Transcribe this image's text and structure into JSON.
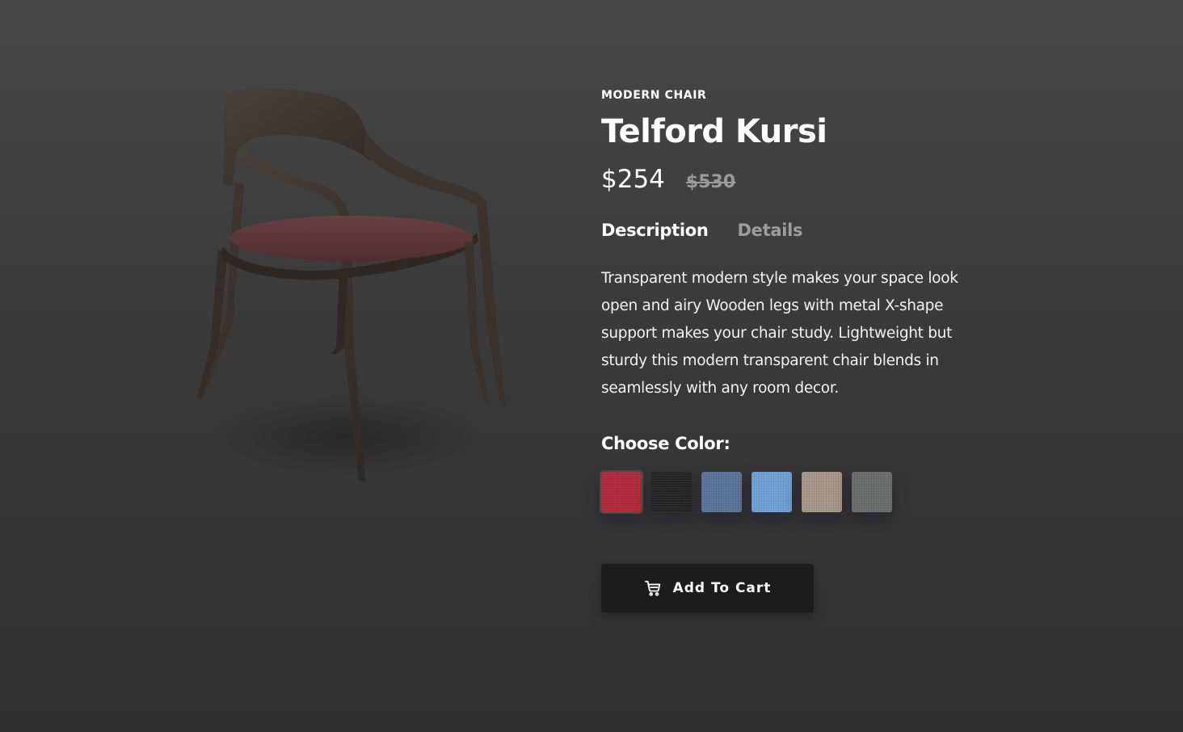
{
  "product": {
    "category": "MODERN CHAIR",
    "title": "Telford Kursi",
    "price_current": "$254",
    "price_old": "$530",
    "image_icon": "chair-image"
  },
  "tabs": [
    {
      "label": "Description",
      "active": true
    },
    {
      "label": "Details",
      "active": false
    }
  ],
  "description": "Transparent modern style makes your space look open and airy Wooden legs with metal X-shape support makes your chair study. Lightweight but sturdy this modern transparent chair blends in seamlessly with any room decor.",
  "colors": {
    "label": "Choose Color:",
    "selected_index": 0,
    "swatches": [
      {
        "name": "red",
        "hex": "#b3293a"
      },
      {
        "name": "black",
        "hex": "#252525"
      },
      {
        "name": "denim-blue",
        "hex": "#5a759a"
      },
      {
        "name": "sky-blue",
        "hex": "#6fa0d4"
      },
      {
        "name": "taupe",
        "hex": "#a89686"
      },
      {
        "name": "grey",
        "hex": "#6a6d6b"
      }
    ]
  },
  "cart": {
    "label": "Add To Cart",
    "icon": "cart-icon"
  },
  "theme": {
    "background": "#3d3d3d",
    "button_bg": "#1c1c1c",
    "muted_text": "#9d9d9d"
  }
}
